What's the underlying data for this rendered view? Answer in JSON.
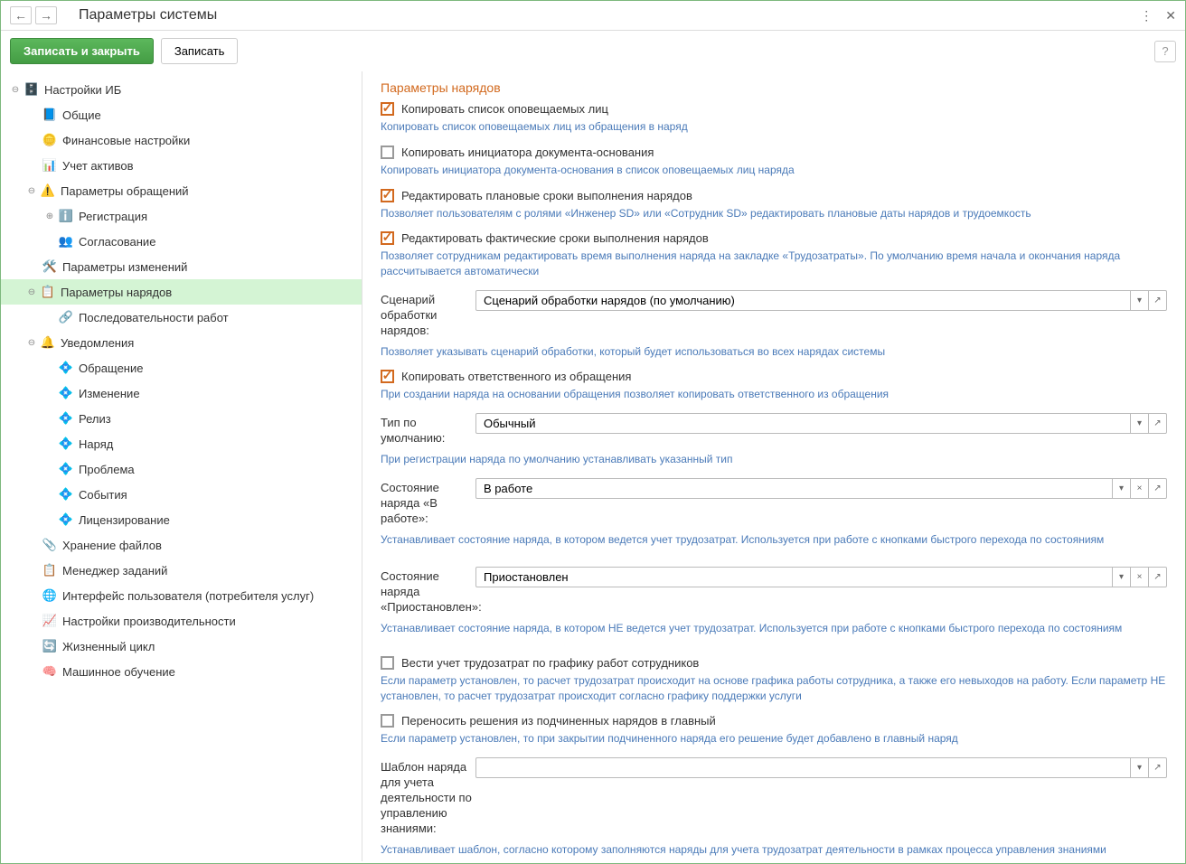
{
  "window": {
    "title": "Параметры системы"
  },
  "toolbar": {
    "save_close": "Записать и закрыть",
    "save": "Записать"
  },
  "tree": {
    "root": "Настройки ИБ",
    "items": {
      "general": "Общие",
      "financial": "Финансовые настройки",
      "assets": "Учет активов",
      "requests": "Параметры обращений",
      "registration": "Регистрация",
      "approval": "Согласование",
      "changes": "Параметры изменений",
      "tasks": "Параметры нарядов",
      "sequences": "Последовательности работ",
      "notifications": "Уведомления",
      "n_request": "Обращение",
      "n_change": "Изменение",
      "n_release": "Релиз",
      "n_task": "Наряд",
      "n_problem": "Проблема",
      "n_events": "События",
      "n_license": "Лицензирование",
      "storage": "Хранение файлов",
      "jobmgr": "Менеджер заданий",
      "ui": "Интерфейс пользователя (потребителя услуг)",
      "perf": "Настройки производительности",
      "lifecycle": "Жизненный цикл",
      "ml": "Машинное обучение"
    }
  },
  "content": {
    "title": "Параметры нарядов",
    "cb1": "Копировать список оповещаемых лиц",
    "hint1": "Копировать список оповещаемых лиц из обращения в наряд",
    "cb2": "Копировать инициатора документа-основания",
    "hint2": "Копировать инициатора документа-основания в список оповещаемых лиц наряда",
    "cb3": "Редактировать плановые сроки выполнения нарядов",
    "hint3": "Позволяет пользователям с ролями «Инженер SD» или «Сотрудник SD» редактировать плановые даты нарядов и трудоемкость",
    "cb4": "Редактировать фактические сроки выполнения нарядов",
    "hint4": "Позволяет сотрудникам редактировать время выполнения наряда на закладке «Трудозатраты». По умолчанию время начала и окончания наряда рассчитывается автоматически",
    "scenario_label": "Сценарий обработки нарядов:",
    "scenario_value": "Сценарий обработки нарядов (по умолчанию)",
    "scenario_hint": "Позволяет указывать сценарий обработки, который будет использоваться во всех нарядах системы",
    "cb5": "Копировать ответственного из обращения",
    "hint5": "При создании наряда на основании обращения  позволяет копировать ответственного из обращения",
    "type_label": "Тип по умолчанию:",
    "type_value": "Обычный",
    "type_hint": "При регистрации наряда по умолчанию устанавливать указанный тип",
    "state1_label": "Состояние наряда «В работе»:",
    "state1_value": "В работе",
    "state1_hint": "Устанавливает состояние наряда, в котором ведется учет трудозатрат. Используется при работе с кнопками быстрого перехода по состояниям",
    "state2_label": "Состояние наряда «Приостановлен»:",
    "state2_value": "Приостановлен",
    "state2_hint": "Устанавливает состояние наряда, в котором НЕ ведется учет трудозатрат. Используется при работе с кнопками быстрого перехода по состояниям",
    "cb6": "Вести учет трудозатрат по графику работ сотрудников",
    "hint6": "Если параметр установлен, то расчет трудозатрат происходит на основе графика работы сотрудника, а также его невыходов на работу. Если параметр НЕ установлен, то расчет трудозатрат происходит согласно графику поддержки услуги",
    "cb7": "Переносить решения из подчиненных нарядов в главный",
    "hint7": "Если параметр установлен, то при закрытии подчиненного наряда его решение будет добавлено в главный наряд",
    "template_label": "Шаблон наряда для учета деятельности по управлению знаниями:",
    "template_value": "",
    "template_hint": "Устанавливает шаблон, согласно которому  заполняются наряды для учета трудозатрат деятельности в рамках процесса управления знаниями"
  }
}
